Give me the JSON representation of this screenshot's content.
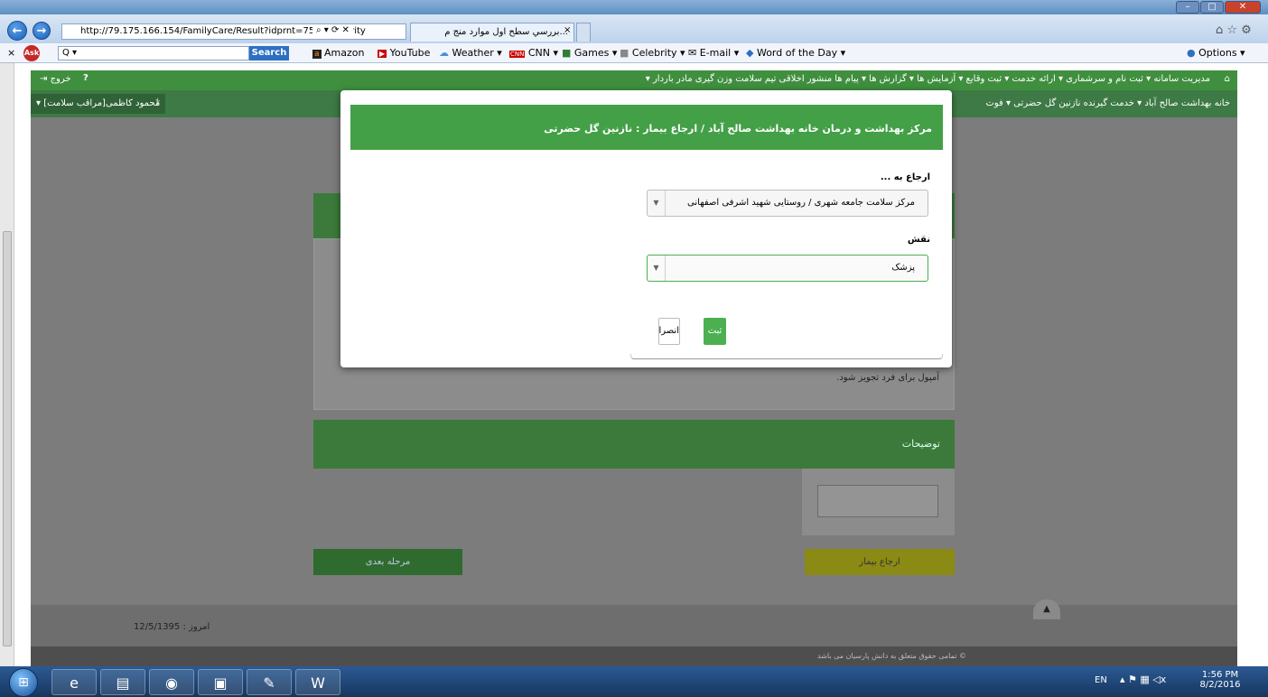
{
  "browser": {
    "url": "http://79.175.166.154/FamilyCare/Result?idprnt=7534&priority",
    "tab_title": "...بررسي سطح اول موارد منج م",
    "toolbar": {
      "search_placeholder": "Q ▾",
      "search_btn": "Search",
      "amazon": "Amazon",
      "youtube": "YouTube",
      "weather": "Weather ▾",
      "cnn": "CNN ▾",
      "games": "Games ▾",
      "celebrity": "Celebrity ▾",
      "email": "E-mail ▾",
      "word": "Word of the Day ▾",
      "options": "Options ▾"
    }
  },
  "app": {
    "logout": "خروج",
    "menu": "مدیریت سامانه ▾ ثبت نام و سرشماری ▾ ارائه خدمت ▾ ثبت وقایع ▾ آزمایش ها ▾ گزارش ها ▾ پیام ها منشور اخلاقی تیم سلامت وزن گیری مادر باردار ▾",
    "breadcrumb": "خانه بهداشت صالح آباد ▾ خدمت گیرنده نازنین گل حضرتی ▾ فوت",
    "user": "محمود کاظمی[مراقب سلامت] ▾",
    "bg_text": "آمپول برای فرد تجویز شود.",
    "notes_title": "توضیحات",
    "next_btn": "مرحله بعدی",
    "refer_btn": "ارجاع بیمار",
    "date": "امروز : 12/5/1395",
    "copyright": "© تمامی حقوق متعلق به دانش پارسیان می باشد"
  },
  "modal": {
    "title": "مرکز بهداشت و درمان خانه بهداشت صالح آباد / ارجاع بیمار : نازنین گل حضرتی",
    "refer_to_label": "ارجاع به ...",
    "refer_to_value": "مرکز سلامت جامعه شهری / روستایی شهید اشرفی اصفهانی",
    "role_label": "نقش",
    "role_value": "پزشک",
    "cancel": "انصراف",
    "submit": "ثبت"
  },
  "taskbar": {
    "lang": "EN",
    "time": "1:56 PM",
    "date": "8/2/2016"
  }
}
